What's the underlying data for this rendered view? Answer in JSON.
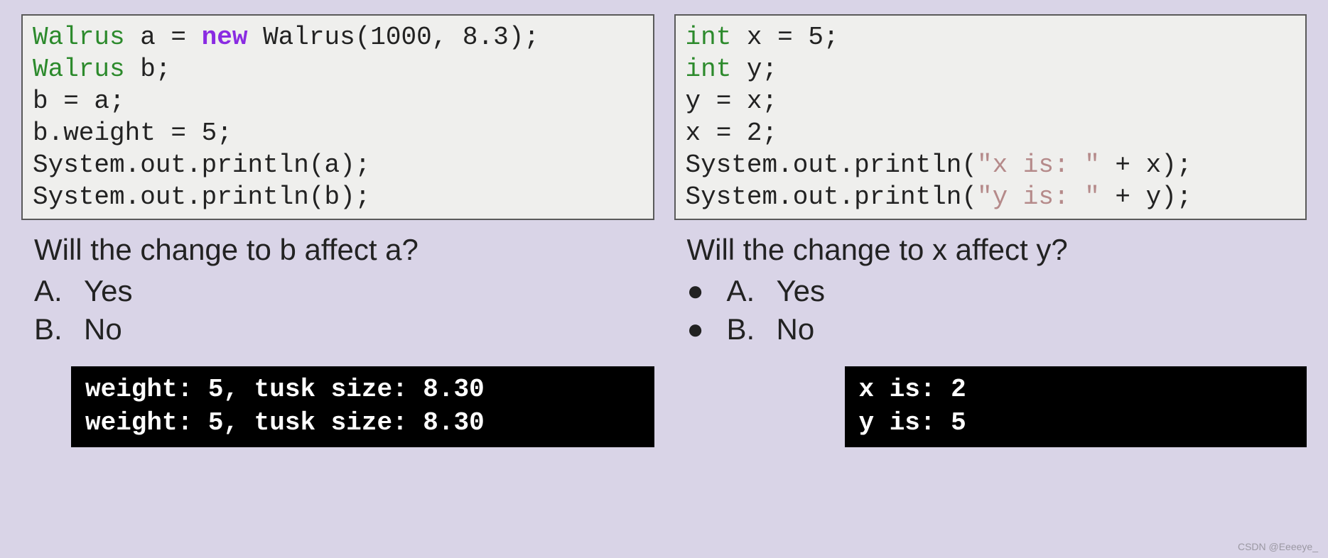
{
  "left": {
    "code": {
      "l1a": "Walrus",
      "l1b": " a = ",
      "l1c": "new",
      "l1d": " Walrus(1000, 8.3);",
      "l2a": "Walrus",
      "l2b": " b;",
      "l3": "b = a;",
      "l4": "b.weight = 5;",
      "l5": "System.out.println(a);",
      "l6": "System.out.println(b);"
    },
    "question": "Will the change to b affect a?",
    "options": [
      {
        "letter": "A.",
        "text": "Yes",
        "bulleted": false
      },
      {
        "letter": "B.",
        "text": "No",
        "bulleted": false
      }
    ],
    "output": "weight: 5, tusk size: 8.30\nweight: 5, tusk size: 8.30"
  },
  "right": {
    "code": {
      "l1a": "int",
      "l1b": " x = 5;",
      "l2a": "int",
      "l2b": " y;",
      "l3": "y = x;",
      "l4": "x = 2;",
      "l5a": "System.out.println(",
      "l5b": "\"x is: \"",
      "l5c": " + x);",
      "l6a": "System.out.println(",
      "l6b": "\"y is: \"",
      "l6c": " + y);"
    },
    "question": "Will the change to x affect y?",
    "options": [
      {
        "letter": "A.",
        "text": "Yes",
        "bulleted": true
      },
      {
        "letter": "B.",
        "text": "No",
        "bulleted": true
      }
    ],
    "output": "x is: 2\ny is: 5"
  },
  "watermark": "CSDN @Eeeeye_"
}
